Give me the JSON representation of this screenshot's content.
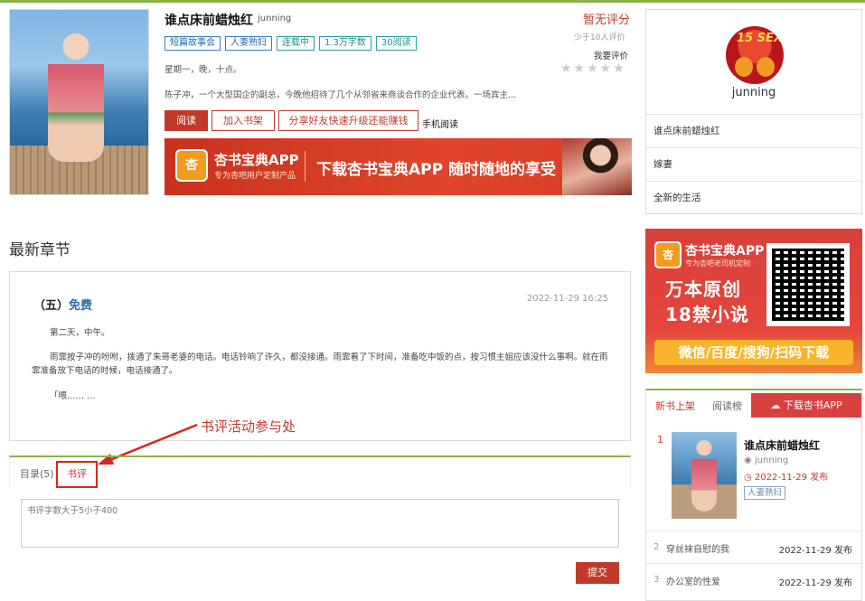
{
  "book": {
    "title": "谁点床前蜡烛红",
    "author": "junning",
    "rating": "暂无评分",
    "raters": "少于10人评价",
    "rate_link": "我要评价",
    "stars": "★★★★★",
    "tags": [
      "短篇故事会",
      "人妻熟妇",
      "连载中",
      "1.3万字数",
      "30阅读"
    ],
    "teaser": "星期一，晚，十点。",
    "summary": "陈子冲，一个大型国企的副总，今晚他招待了几个从邻省来商谈合作的企业代表。一场宾主...",
    "buttons": {
      "read": "阅读",
      "shelf": "加入书架",
      "share": "分享好友快速升级还能赚钱"
    },
    "mobile": "手机阅读"
  },
  "banner": {
    "logo": "杏",
    "app_name": "杏书宝典APP",
    "app_sub": "专为杏吧用户定制产品",
    "slogan": "下载杏书宝典APP 随时随地的享受"
  },
  "author_card": {
    "avatar_text": "15 SEX",
    "name": "junning",
    "works": [
      "谁点床前蜡烛红",
      "嫁妻",
      "全新的生活"
    ]
  },
  "ad": {
    "logo": "杏",
    "title": "杏书宝典APP",
    "sub": "专为杏吧老司机定制",
    "line1": "万本原创",
    "line2": "18禁小说",
    "bar": "微信/百度/搜狗/扫码下载"
  },
  "ranking": {
    "tabs": [
      "新书上架",
      "阅读榜"
    ],
    "download": "下载杏书APP",
    "top": {
      "rank": "1",
      "title": "谁点床前蜡烛红",
      "author": "junning",
      "date": "2022-11-29 发布",
      "tag": "人妻熟妇"
    },
    "rows": [
      {
        "n": "2",
        "title": "穿丝袜自慰的我",
        "date": "2022-11-29 发布"
      },
      {
        "n": "3",
        "title": "办公室的性爱",
        "date": "2022-11-29 发布"
      }
    ]
  },
  "latest": {
    "heading": "最新章节",
    "chapter_title": "（五）",
    "free": "免费",
    "date": "2022-11-29 16:25",
    "p1": "第二天，中午。",
    "p2": "雨霏按子冲的吩咐，拨通了朱哥老婆的电话。电话铃响了许久，都没接通。雨霏看了下时间，准备吃中饭的点，按习惯主姐应该没什么事啊。就在雨霏准备放下电话的时候，电话接通了。",
    "p3": "「喂…… …"
  },
  "annotation": "书评活动参与处",
  "tabs": {
    "catalog": "目录(5)",
    "review": "书评"
  },
  "review": {
    "placeholder": "书评字数大于5小于400",
    "submit": "提交"
  }
}
